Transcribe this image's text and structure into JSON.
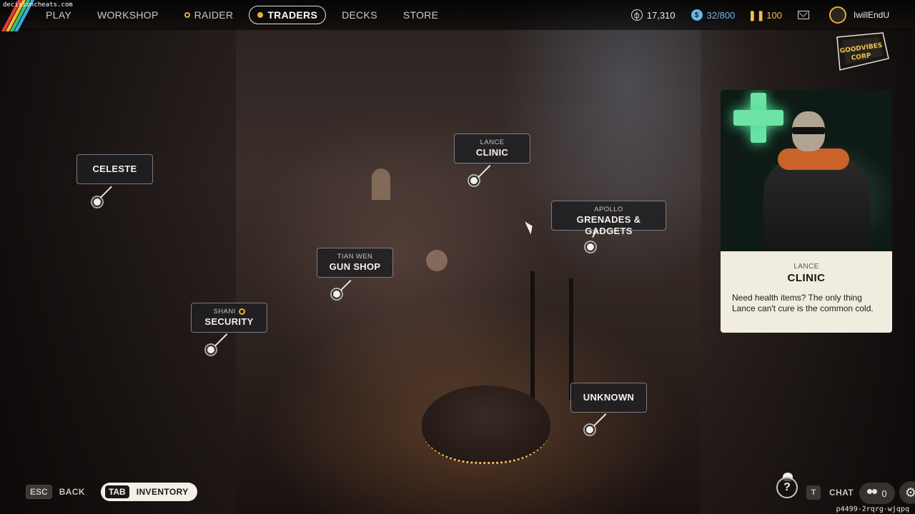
{
  "watermark": "decisioncheats.com",
  "nav": {
    "items": [
      {
        "label": "PLAY",
        "dot": false,
        "active": false
      },
      {
        "label": "WORKSHOP",
        "dot": false,
        "active": false
      },
      {
        "label": "RAIDER",
        "dot": true,
        "active": false
      },
      {
        "label": "TRADERS",
        "dot": true,
        "active": true
      },
      {
        "label": "DECKS",
        "dot": false,
        "active": false
      },
      {
        "label": "STORE",
        "dot": false,
        "active": false
      }
    ]
  },
  "currencies": {
    "coins": "17,310",
    "tokens": "32/800",
    "credits": "100"
  },
  "profile": {
    "username": "IwillEndU"
  },
  "clan_badge": {
    "text": "GOODVIBES CORP"
  },
  "markers": {
    "celeste": {
      "sub": "",
      "main": "CELESTE"
    },
    "clinic": {
      "sub": "LANCE",
      "main": "CLINIC"
    },
    "grenades": {
      "sub": "APOLLO",
      "main": "GRENADES & GADGETS"
    },
    "gunshop": {
      "sub": "TIAN WEN",
      "main": "GUN SHOP"
    },
    "security": {
      "sub": "SHANI",
      "main": "SECURITY"
    },
    "unknown": {
      "sub": "",
      "main": "UNKNOWN"
    }
  },
  "card": {
    "sub": "LANCE",
    "title": "CLINIC",
    "description": "Need health items? The only thing Lance can't cure is the common cold."
  },
  "bottom": {
    "esc_key": "ESC",
    "back_label": "BACK",
    "tab_key": "TAB",
    "inventory_label": "INVENTORY",
    "help_label": "?",
    "chat_key": "T",
    "chat_label": "CHAT",
    "friends_count": "0",
    "settings_icon": "gear-icon"
  },
  "session_id": "p4499-2rqrg-wjqpq",
  "colors": {
    "accent_gold": "#e6b03a",
    "token_blue": "#6bb6e8",
    "card_bg": "#f1ece0",
    "clinic_green": "#6de3a6"
  }
}
